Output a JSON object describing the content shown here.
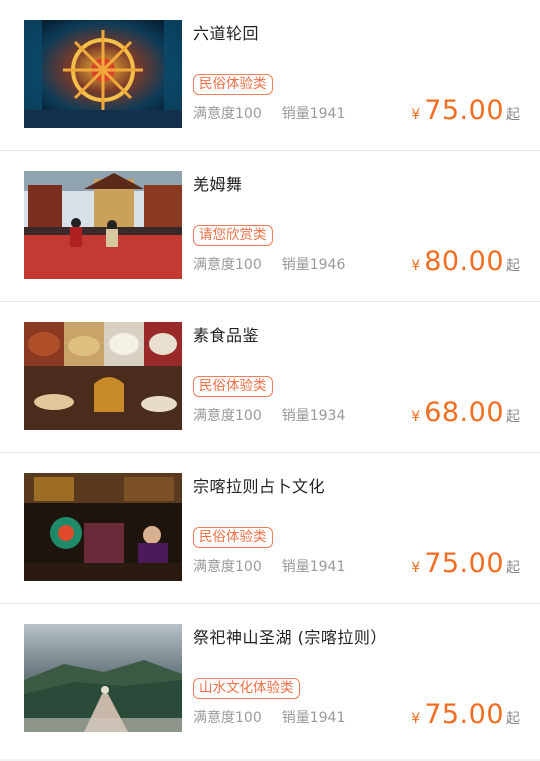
{
  "items": [
    {
      "title": "六道轮回",
      "tag": "民俗体验类",
      "satisfaction": "满意度100",
      "sales": "销量1941",
      "currency": "¥",
      "price": "75.00",
      "suffix": "起",
      "image": "wheel-of-life-image"
    },
    {
      "title": "羌姆舞",
      "tag": "请您欣赏类",
      "satisfaction": "满意度100",
      "sales": "销量1946",
      "currency": "¥",
      "price": "80.00",
      "suffix": "起",
      "image": "cham-dance-image"
    },
    {
      "title": "素食品鉴",
      "tag": "民俗体验类",
      "satisfaction": "满意度100",
      "sales": "销量1934",
      "currency": "¥",
      "price": "68.00",
      "suffix": "起",
      "image": "vegetarian-food-image"
    },
    {
      "title": "宗喀拉则占卜文化",
      "tag": "民俗体验类",
      "satisfaction": "满意度100",
      "sales": "销量1941",
      "currency": "¥",
      "price": "75.00",
      "suffix": "起",
      "image": "divination-image"
    },
    {
      "title": "祭祀神山圣湖 (宗喀拉则）",
      "tag": "山水文化体验类",
      "satisfaction": "满意度100",
      "sales": "销量1941",
      "currency": "¥",
      "price": "75.00",
      "suffix": "起",
      "image": "sacred-mountain-image"
    }
  ],
  "colors": {
    "accent": "#f26d21",
    "tag": "#ef6f45",
    "muted": "#9a9a9a"
  }
}
